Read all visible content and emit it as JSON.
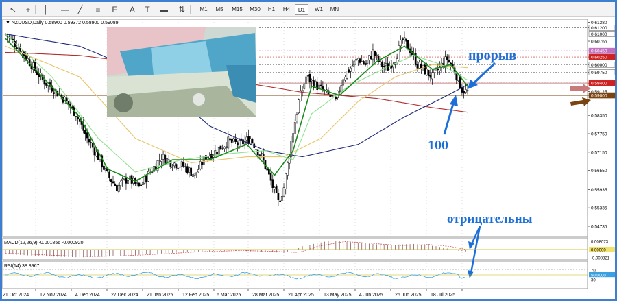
{
  "toolbar": {
    "tools": [
      {
        "name": "cursor-icon",
        "glyph": "↖"
      },
      {
        "name": "crosshair-icon",
        "glyph": "+"
      },
      {
        "name": "vertical-line-icon",
        "glyph": "│"
      },
      {
        "name": "horizontal-line-icon",
        "glyph": "—"
      },
      {
        "name": "trendline-icon",
        "glyph": "╱"
      },
      {
        "name": "channel-icon",
        "glyph": "≡"
      },
      {
        "name": "fibonacci-icon",
        "glyph": "F"
      },
      {
        "name": "text-icon",
        "glyph": "A"
      },
      {
        "name": "text-label-icon",
        "glyph": "T"
      },
      {
        "name": "rectangle-icon",
        "glyph": "▬"
      },
      {
        "name": "arrows-icon",
        "glyph": "⇅"
      }
    ],
    "timeframes": [
      "M1",
      "M5",
      "M15",
      "M30",
      "H1",
      "H4",
      "D1",
      "W1",
      "MN"
    ],
    "active_timeframe": "D1"
  },
  "header": {
    "symbol_line": "NZDUSD,Daily  0.58900 0.59372 0.58900 0.59089"
  },
  "macd_header": "MACD(12,26,9) -0.001856 -0.000920",
  "rsi_header": "RSI(14) 38.8967",
  "annotations": {
    "breakout": "прорыв",
    "ma100": "100",
    "negative": "отрицательны"
  },
  "colors": {
    "accent_blue": "#1c6fd6",
    "ema_fast": "#1a8a1a",
    "ema_mid": "#8fe28f",
    "ma_50": "#e9c46a",
    "ma_100": "#1f2a7a",
    "ma_200": "#b03030",
    "support_line": "#7a4310",
    "resistance_line": "#b06a6a",
    "arrow_pink": "#c77b7b",
    "arrow_brown": "#7a4310",
    "macd_hist": "#8a5a5a",
    "rsi_line": "#3aa0e0"
  },
  "chart_data": {
    "type": "candlestick",
    "symbol": "NZDUSD",
    "timeframe": "Daily",
    "ohlc_last": {
      "open": 0.589,
      "high": 0.59372,
      "low": 0.589,
      "close": 0.59089
    },
    "ylim": [
      0.544,
      0.6148
    ],
    "price_ticks": [
      0.6138,
      0.612,
      0.61,
      0.60765,
      0.6045,
      0.6025,
      0.6,
      0.5975,
      0.594,
      0.59125,
      0.59,
      0.5835,
      0.5775,
      0.5715,
      0.5655,
      0.55935,
      0.55335,
      0.54735
    ],
    "highlighted_levels": [
      {
        "value": 0.612,
        "color": "#6a6a6a"
      },
      {
        "value": 0.61,
        "color": "#6a6a6a"
      },
      {
        "value": 0.6045,
        "color": "#c070c0"
      },
      {
        "value": 0.6025,
        "color": "#cc2222"
      },
      {
        "value": 0.6,
        "color": "#6a6a6a"
      },
      {
        "value": 0.5975,
        "color": "#6a6a6a"
      },
      {
        "value": 0.594,
        "color": "#cc2222"
      },
      {
        "value": 0.59,
        "color": "#7a4310"
      }
    ],
    "x_labels": [
      "21 Oct 2024",
      "12 Nov 2024",
      "4 Dec 2024",
      "27 Dec 2024",
      "21 Jan 2025",
      "12 Feb 2025",
      "6 Mar 2025",
      "28 Mar 2025",
      "21 Apr 2025",
      "13 May 2025",
      "4 Jun 2025",
      "26 Jun 2025",
      "18 Jul 2025"
    ],
    "price_path": [
      [
        0,
        0.61
      ],
      [
        8,
        0.605
      ],
      [
        14,
        0.6
      ],
      [
        20,
        0.595
      ],
      [
        26,
        0.592
      ],
      [
        32,
        0.5885
      ],
      [
        38,
        0.584
      ],
      [
        44,
        0.576
      ],
      [
        50,
        0.57
      ],
      [
        55,
        0.564
      ],
      [
        60,
        0.56
      ],
      [
        66,
        0.563
      ],
      [
        72,
        0.56
      ],
      [
        78,
        0.565
      ],
      [
        84,
        0.57
      ],
      [
        90,
        0.568
      ],
      [
        96,
        0.567
      ],
      [
        102,
        0.564
      ],
      [
        108,
        0.57
      ],
      [
        114,
        0.572
      ],
      [
        120,
        0.575
      ],
      [
        126,
        0.574
      ],
      [
        132,
        0.576
      ],
      [
        138,
        0.57
      ],
      [
        143,
        0.562
      ],
      [
        147,
        0.555
      ],
      [
        150,
        0.56
      ],
      [
        154,
        0.575
      ],
      [
        158,
        0.588
      ],
      [
        162,
        0.596
      ],
      [
        166,
        0.594
      ],
      [
        170,
        0.592
      ],
      [
        174,
        0.59
      ],
      [
        178,
        0.588
      ],
      [
        182,
        0.596
      ],
      [
        186,
        0.599
      ],
      [
        190,
        0.602
      ],
      [
        194,
        0.6
      ],
      [
        198,
        0.604
      ],
      [
        202,
        0.6
      ],
      [
        206,
        0.599
      ],
      [
        210,
        0.602
      ],
      [
        214,
        0.608
      ],
      [
        218,
        0.605
      ],
      [
        222,
        0.6
      ],
      [
        226,
        0.598
      ],
      [
        230,
        0.596
      ],
      [
        234,
        0.599
      ],
      [
        238,
        0.602
      ],
      [
        242,
        0.598
      ],
      [
        246,
        0.592
      ],
      [
        249,
        0.5909
      ]
    ],
    "series": [
      {
        "name": "EMA fast",
        "color": "#1a8a1a",
        "values": [
          [
            0,
            0.6085
          ],
          [
            20,
            0.596
          ],
          [
            40,
            0.583
          ],
          [
            55,
            0.566
          ],
          [
            70,
            0.562
          ],
          [
            90,
            0.569
          ],
          [
            110,
            0.569
          ],
          [
            130,
            0.574
          ],
          [
            145,
            0.564
          ],
          [
            155,
            0.572
          ],
          [
            165,
            0.593
          ],
          [
            180,
            0.59
          ],
          [
            200,
            0.601
          ],
          [
            215,
            0.606
          ],
          [
            230,
            0.5985
          ],
          [
            240,
            0.6
          ],
          [
            249,
            0.593
          ]
        ]
      },
      {
        "name": "EMA mid",
        "color": "#8fe28f",
        "values": [
          [
            0,
            0.61
          ],
          [
            25,
            0.596
          ],
          [
            50,
            0.576
          ],
          [
            70,
            0.565
          ],
          [
            95,
            0.569
          ],
          [
            120,
            0.571
          ],
          [
            140,
            0.572
          ],
          [
            155,
            0.569
          ],
          [
            165,
            0.584
          ],
          [
            185,
            0.593
          ],
          [
            205,
            0.599
          ],
          [
            220,
            0.603
          ],
          [
            235,
            0.6
          ],
          [
            249,
            0.595
          ]
        ]
      },
      {
        "name": "MA 50",
        "color": "#e9c46a",
        "values": [
          [
            0,
            0.606
          ],
          [
            40,
            0.596
          ],
          [
            70,
            0.576
          ],
          [
            100,
            0.568
          ],
          [
            130,
            0.57
          ],
          [
            150,
            0.57
          ],
          [
            170,
            0.576
          ],
          [
            190,
            0.588
          ],
          [
            210,
            0.596
          ],
          [
            230,
            0.6
          ],
          [
            249,
            0.599
          ]
        ]
      },
      {
        "name": "MA 100",
        "color": "#1f2a7a",
        "values": [
          [
            0,
            0.61
          ],
          [
            40,
            0.606
          ],
          [
            80,
            0.596
          ],
          [
            110,
            0.58
          ],
          [
            140,
            0.572
          ],
          [
            160,
            0.57
          ],
          [
            190,
            0.574
          ],
          [
            215,
            0.583
          ],
          [
            235,
            0.589
          ],
          [
            249,
            0.5935
          ]
        ]
      },
      {
        "name": "MA 200",
        "color": "#b03030",
        "values": [
          [
            0,
            0.604
          ],
          [
            40,
            0.603
          ],
          [
            80,
            0.6
          ],
          [
            120,
            0.595
          ],
          [
            160,
            0.591
          ],
          [
            200,
            0.589
          ],
          [
            230,
            0.586
          ],
          [
            249,
            0.5845
          ]
        ]
      }
    ],
    "macd": {
      "ylim": [
        -0.008321,
        0.008073
      ],
      "ticks": [
        0.008073,
        0.0,
        -0.008321
      ]
    },
    "rsi": {
      "ylim": [
        0,
        100
      ],
      "ticks": [
        70,
        50,
        30
      ]
    }
  }
}
